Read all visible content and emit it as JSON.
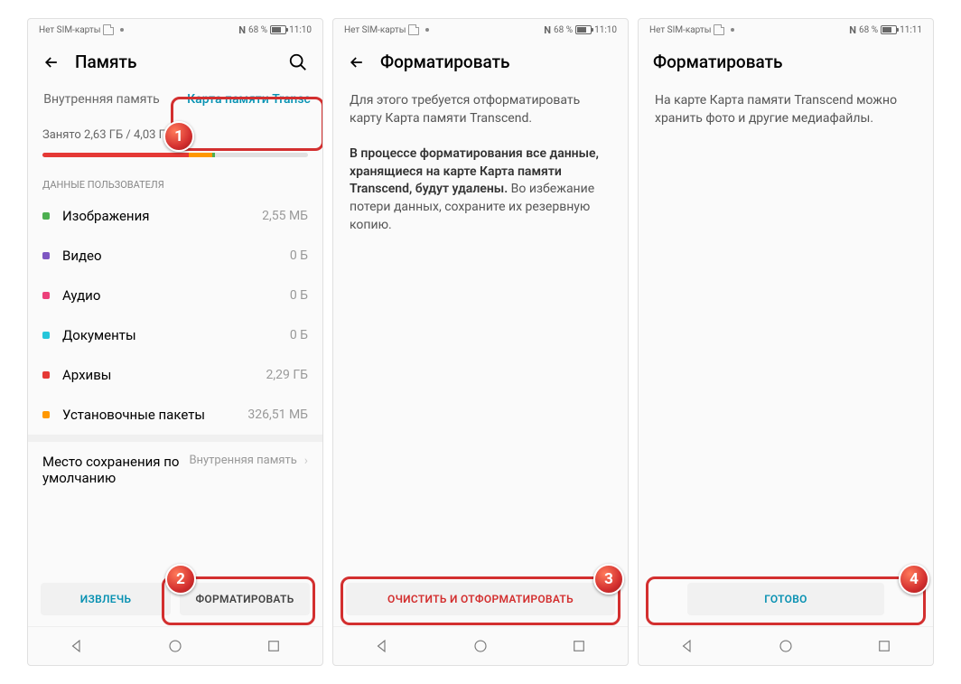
{
  "status": {
    "sim_text": "Нет SIM-карты",
    "nfc": "N",
    "battery_pct": "68 %",
    "time1": "11:10",
    "time3": "11:11"
  },
  "screen1": {
    "title": "Память",
    "tabs": {
      "internal": "Внутренняя память",
      "card": "Карта памяти Transc"
    },
    "used": "Занято 2,63 ГБ / 4,03 ГБ",
    "section": "ДАННЫЕ ПОЛЬЗОВАТЕЛЯ",
    "rows": [
      {
        "label": "Изображения",
        "value": "2,55 МБ",
        "color": "#4caf50"
      },
      {
        "label": "Видео",
        "value": "0 Б",
        "color": "#7e57c2"
      },
      {
        "label": "Аудио",
        "value": "0 Б",
        "color": "#ec407a"
      },
      {
        "label": "Документы",
        "value": "0 Б",
        "color": "#26c6da"
      },
      {
        "label": "Архивы",
        "value": "2,29 ГБ",
        "color": "#e53935"
      },
      {
        "label": "Установочные пакеты",
        "value": "326,51 МБ",
        "color": "#ff9800"
      }
    ],
    "default": {
      "label": "Место сохранения по умолчанию",
      "value": "Внутренняя память"
    },
    "btn_eject": "ИЗВЛЕЧЬ",
    "btn_format": "ФОРМАТИРОВАТЬ"
  },
  "screen2": {
    "title": "Форматировать",
    "p1": "Для этого требуется отформатировать карту Карта памяти Transcend.",
    "p2_bold": "В процессе форматирования все данные, хранящиеся на карте Карта памяти Transcend, будут удалены.",
    "p2_rest": " Во избежание потери данных, сохраните их резервную копию.",
    "btn": "ОЧИСТИТЬ И ОТФОРМАТИРОВАТЬ"
  },
  "screen3": {
    "title": "Форматировать",
    "p1": "На карте Карта памяти Transcend можно хранить фото и другие медиафайлы.",
    "btn": "ГОТОВО"
  },
  "steps": {
    "s1": "1",
    "s2": "2",
    "s3": "3",
    "s4": "4"
  }
}
